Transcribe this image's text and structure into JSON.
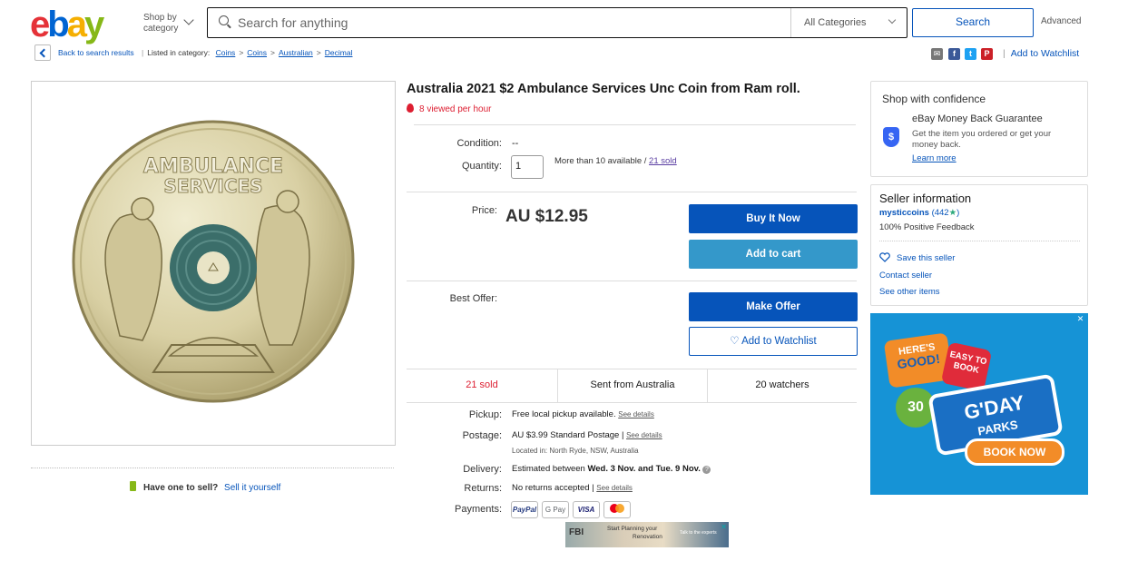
{
  "header": {
    "logo_letters": [
      "e",
      "b",
      "a",
      "y"
    ],
    "shop_by": "Shop by",
    "category": "category",
    "search_placeholder": "Search for anything",
    "category_select": "All Categories",
    "search_button": "Search",
    "advanced": "Advanced"
  },
  "breadcrumb": {
    "back": "Back to search results",
    "listed_in": "Listed in category:",
    "items": [
      "Coins",
      "Coins",
      "Australian",
      "Decimal"
    ],
    "add_to_watchlist": "Add to Watchlist"
  },
  "share_icons": [
    "email-icon",
    "facebook-icon",
    "twitter-icon",
    "pinterest-icon"
  ],
  "image_panel": {
    "coin_text_top": "AMBULANCE",
    "coin_text_bottom": "SERVICES"
  },
  "sell": {
    "prompt": "Have one to sell?",
    "link": "Sell it yourself"
  },
  "listing": {
    "title": "Australia 2021 $2 Ambulance Services Unc Coin from Ram roll.",
    "hot": "8 viewed per hour",
    "condition_label": "Condition:",
    "condition_value": "--",
    "quantity_label": "Quantity:",
    "quantity_value": "1",
    "availability": "More than 10 available /",
    "sold_link": "21 sold",
    "price_label": "Price:",
    "price": "AU $12.95",
    "buy_now": "Buy It Now",
    "add_to_cart": "Add to cart",
    "best_offer_label": "Best Offer:",
    "make_offer": "Make Offer",
    "watchlist": "♡ Add to Watchlist",
    "stats": [
      "21 sold",
      "Sent from Australia",
      "20 watchers"
    ],
    "pickup_label": "Pickup:",
    "pickup_value": "Free local pickup available.",
    "see_details": "See details",
    "postage_label": "Postage:",
    "postage_value": "AU $3.99  Standard Postage |",
    "located": "Located in:  North Ryde, NSW, Australia",
    "delivery_label": "Delivery:",
    "delivery_value": "Estimated between",
    "delivery_dates": "Wed. 3 Nov. and Tue. 9 Nov.",
    "returns_label": "Returns:",
    "returns_value": "No returns accepted |",
    "payments_label": "Payments:",
    "payment_methods": [
      "PayPal",
      "G Pay",
      "VISA",
      "mastercard"
    ],
    "ad_text_1": "Start Planning your",
    "ad_text_2": "Renovation",
    "ad_cta": "Talk to the experts"
  },
  "confidence": {
    "title": "Shop with confidence",
    "guarantee": "eBay Money Back Guarantee",
    "desc": "Get the item you ordered or get your money back.",
    "learn_more": "Learn more"
  },
  "seller": {
    "heading": "Seller information",
    "name": "mysticcoins",
    "score": "(442",
    "score_end": ")",
    "feedback": "100% Positive Feedback",
    "save": "Save this seller",
    "contact": "Contact seller",
    "other": "See other items"
  },
  "big_ad": {
    "heres": "HERE'S",
    "good": "GOOD!",
    "easy": "EASY TO BOOK",
    "thirty": "30",
    "gday": "G'DAY",
    "parks": "PARKS",
    "book": "BOOK NOW",
    "close": "✕"
  },
  "colors": {
    "primary_blue": "#0654ba",
    "cart_blue": "#3498ca",
    "hot_red": "#dd1e31"
  }
}
